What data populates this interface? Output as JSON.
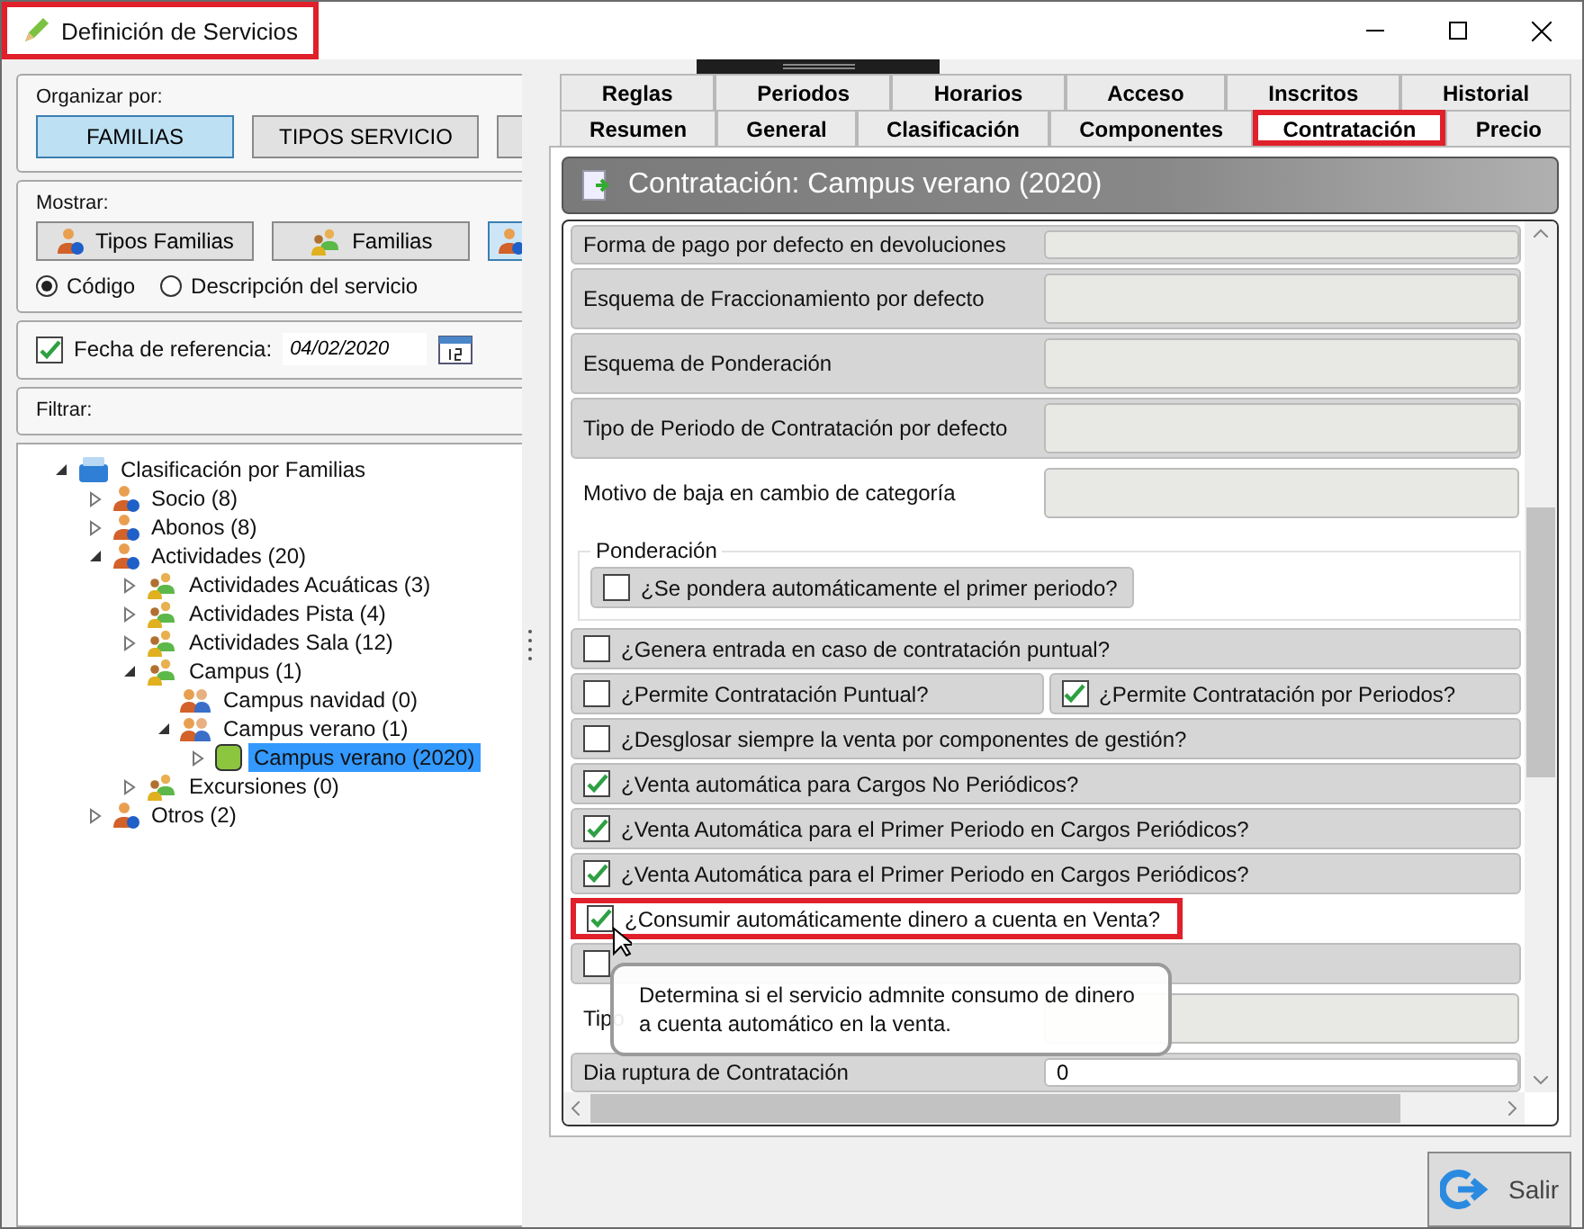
{
  "window": {
    "title": "Definición de Servicios",
    "highlighted": true
  },
  "organize": {
    "label": "Organizar por:",
    "buttons": [
      {
        "label": "FAMILIAS",
        "selected": true
      },
      {
        "label": "TIPOS SERVICIO",
        "selected": false
      },
      {
        "selected": false
      }
    ]
  },
  "show": {
    "label": "Mostrar:",
    "buttons": [
      {
        "label": "Tipos Familias",
        "kind": "person",
        "selected": false
      },
      {
        "label": "Familias",
        "kind": "group",
        "selected": false
      },
      {
        "kind": "person",
        "selected": true
      }
    ]
  },
  "display_options": [
    {
      "label": "Código",
      "selected": true
    },
    {
      "label": "Descripción del servicio",
      "selected": false
    }
  ],
  "reference_date": {
    "label": "Fecha de referencia:",
    "checked": true,
    "value": "04/02/2020"
  },
  "filter": {
    "label": "Filtrar:"
  },
  "tree": [
    {
      "label": "Clasificación por Familias",
      "kind": "root",
      "expanded": true,
      "selected": false,
      "children": [
        {
          "label": "Socio (8)",
          "kind": "person",
          "expanded": false,
          "selected": false
        },
        {
          "label": "Abonos (8)",
          "kind": "person",
          "expanded": false,
          "selected": false
        },
        {
          "label": "Actividades (20)",
          "kind": "person",
          "expanded": true,
          "selected": false,
          "children": [
            {
              "label": "Actividades Acuáticas (3)",
              "kind": "group",
              "expanded": false,
              "selected": false
            },
            {
              "label": "Actividades Pista (4)",
              "kind": "group",
              "expanded": false,
              "selected": false
            },
            {
              "label": "Actividades Sala (12)",
              "kind": "group",
              "expanded": false,
              "selected": false
            },
            {
              "label": "Campus (1)",
              "kind": "group",
              "expanded": true,
              "selected": false,
              "children": [
                {
                  "label": "Campus navidad (0)",
                  "kind": "pair",
                  "selected": false
                },
                {
                  "label": "Campus verano (1)",
                  "kind": "pair",
                  "expanded": true,
                  "selected": false,
                  "children": [
                    {
                      "label": "Campus verano (2020)",
                      "kind": "service",
                      "expanded": false,
                      "selected": true
                    }
                  ]
                }
              ]
            },
            {
              "label": "Excursiones (0)",
              "kind": "group",
              "expanded": false,
              "selected": false
            }
          ]
        },
        {
          "label": "Otros (2)",
          "kind": "person",
          "expanded": false,
          "selected": false
        }
      ]
    }
  ],
  "tab_rows": [
    [
      {
        "label": "Reglas",
        "selected": false,
        "highlighted": false
      },
      {
        "label": "Periodos",
        "selected": false,
        "highlighted": false
      },
      {
        "label": "Horarios",
        "selected": false,
        "highlighted": false
      },
      {
        "label": "Acceso",
        "selected": false,
        "highlighted": false
      },
      {
        "label": "Inscritos",
        "selected": false,
        "highlighted": false
      },
      {
        "label": "Historial",
        "selected": false,
        "highlighted": false
      }
    ],
    [
      {
        "label": "Resumen",
        "selected": false,
        "highlighted": false
      },
      {
        "label": "General",
        "selected": false,
        "highlighted": false
      },
      {
        "label": "Clasificación",
        "selected": false,
        "highlighted": false
      },
      {
        "label": "Componentes",
        "selected": false,
        "highlighted": false
      },
      {
        "label": "Contratación",
        "selected": true,
        "highlighted": true
      },
      {
        "label": "Precio",
        "selected": false,
        "highlighted": false
      }
    ]
  ],
  "header": {
    "title": "Contratación: Campus verano (2020)"
  },
  "form": [
    {
      "kind": "field",
      "label": "Forma de pago por defecto en devoluciones",
      "short": true
    },
    {
      "kind": "field",
      "label": "Esquema de Fraccionamiento por defecto"
    },
    {
      "kind": "field",
      "label": "Esquema de Ponderación"
    },
    {
      "kind": "field",
      "label": "Tipo de Periodo de Contratación por defecto"
    },
    {
      "kind": "field",
      "label": "Motivo de baja en cambio de categoría",
      "plain": true
    },
    {
      "kind": "group",
      "title": "Ponderación",
      "items": [
        {
          "label": "¿Se pondera automáticamente el primer periodo?",
          "checked": false
        }
      ]
    },
    {
      "kind": "check",
      "label": "¿Genera entrada en caso de contratación puntual?",
      "checked": false,
      "highlighted": false
    },
    {
      "kind": "pair",
      "items": [
        {
          "label": "¿Permite Contratación Puntual?",
          "checked": false
        },
        {
          "label": "¿Permite Contratación por Periodos?",
          "checked": true
        }
      ]
    },
    {
      "kind": "check",
      "label": "¿Desglosar siempre la venta por componentes de gestión?",
      "checked": false,
      "highlighted": false
    },
    {
      "kind": "check",
      "label": "¿Venta automática para Cargos No Periódicos?",
      "checked": true,
      "highlighted": false
    },
    {
      "kind": "check",
      "label": "¿Venta Automática para el Primer Periodo en Cargos Periódicos?",
      "checked": true,
      "highlighted": false
    },
    {
      "kind": "check",
      "label": "¿Venta Automática para el Primer Periodo en Cargos Periódicos?",
      "checked": true,
      "highlighted": false
    },
    {
      "kind": "check",
      "label": "¿Consumir automáticamente dinero a cuenta en Venta?",
      "checked": true,
      "highlighted": true
    },
    {
      "kind": "check",
      "checked": false,
      "highlighted": false
    },
    {
      "kind": "field",
      "label": "Tipo",
      "plain": true
    },
    {
      "kind": "field",
      "label": "Dia ruptura de Contratación",
      "value": "0",
      "short": true
    }
  ],
  "tooltip": {
    "text": "Determina si el servicio admnite consumo de dinero a cuenta automático en la venta."
  },
  "exit_button": {
    "label": "Salir"
  }
}
